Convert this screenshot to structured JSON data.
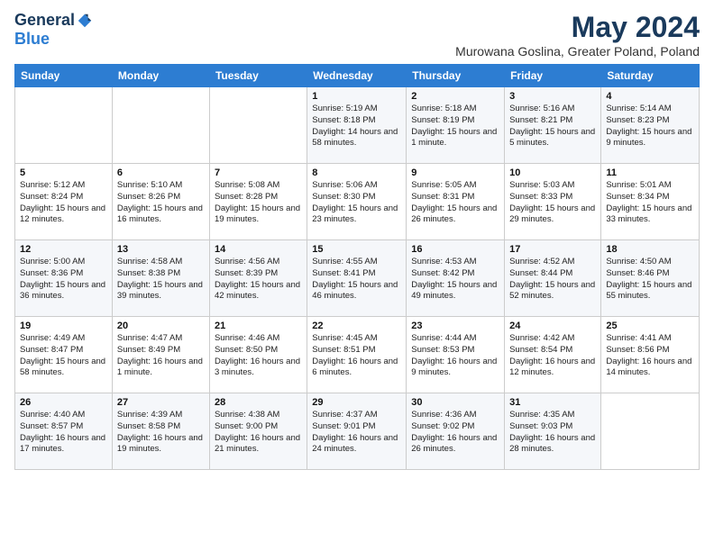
{
  "header": {
    "logo": {
      "general": "General",
      "blue": "Blue"
    },
    "title": "May 2024",
    "subtitle": "Murowana Goslina, Greater Poland, Poland"
  },
  "calendar": {
    "weekdays": [
      "Sunday",
      "Monday",
      "Tuesday",
      "Wednesday",
      "Thursday",
      "Friday",
      "Saturday"
    ],
    "weeks": [
      [
        {
          "day": "",
          "info": ""
        },
        {
          "day": "",
          "info": ""
        },
        {
          "day": "",
          "info": ""
        },
        {
          "day": "1",
          "info": "Sunrise: 5:19 AM\nSunset: 8:18 PM\nDaylight: 14 hours\nand 58 minutes."
        },
        {
          "day": "2",
          "info": "Sunrise: 5:18 AM\nSunset: 8:19 PM\nDaylight: 15 hours\nand 1 minute."
        },
        {
          "day": "3",
          "info": "Sunrise: 5:16 AM\nSunset: 8:21 PM\nDaylight: 15 hours\nand 5 minutes."
        },
        {
          "day": "4",
          "info": "Sunrise: 5:14 AM\nSunset: 8:23 PM\nDaylight: 15 hours\nand 9 minutes."
        }
      ],
      [
        {
          "day": "5",
          "info": "Sunrise: 5:12 AM\nSunset: 8:24 PM\nDaylight: 15 hours\nand 12 minutes."
        },
        {
          "day": "6",
          "info": "Sunrise: 5:10 AM\nSunset: 8:26 PM\nDaylight: 15 hours\nand 16 minutes."
        },
        {
          "day": "7",
          "info": "Sunrise: 5:08 AM\nSunset: 8:28 PM\nDaylight: 15 hours\nand 19 minutes."
        },
        {
          "day": "8",
          "info": "Sunrise: 5:06 AM\nSunset: 8:30 PM\nDaylight: 15 hours\nand 23 minutes."
        },
        {
          "day": "9",
          "info": "Sunrise: 5:05 AM\nSunset: 8:31 PM\nDaylight: 15 hours\nand 26 minutes."
        },
        {
          "day": "10",
          "info": "Sunrise: 5:03 AM\nSunset: 8:33 PM\nDaylight: 15 hours\nand 29 minutes."
        },
        {
          "day": "11",
          "info": "Sunrise: 5:01 AM\nSunset: 8:34 PM\nDaylight: 15 hours\nand 33 minutes."
        }
      ],
      [
        {
          "day": "12",
          "info": "Sunrise: 5:00 AM\nSunset: 8:36 PM\nDaylight: 15 hours\nand 36 minutes."
        },
        {
          "day": "13",
          "info": "Sunrise: 4:58 AM\nSunset: 8:38 PM\nDaylight: 15 hours\nand 39 minutes."
        },
        {
          "day": "14",
          "info": "Sunrise: 4:56 AM\nSunset: 8:39 PM\nDaylight: 15 hours\nand 42 minutes."
        },
        {
          "day": "15",
          "info": "Sunrise: 4:55 AM\nSunset: 8:41 PM\nDaylight: 15 hours\nand 46 minutes."
        },
        {
          "day": "16",
          "info": "Sunrise: 4:53 AM\nSunset: 8:42 PM\nDaylight: 15 hours\nand 49 minutes."
        },
        {
          "day": "17",
          "info": "Sunrise: 4:52 AM\nSunset: 8:44 PM\nDaylight: 15 hours\nand 52 minutes."
        },
        {
          "day": "18",
          "info": "Sunrise: 4:50 AM\nSunset: 8:46 PM\nDaylight: 15 hours\nand 55 minutes."
        }
      ],
      [
        {
          "day": "19",
          "info": "Sunrise: 4:49 AM\nSunset: 8:47 PM\nDaylight: 15 hours\nand 58 minutes."
        },
        {
          "day": "20",
          "info": "Sunrise: 4:47 AM\nSunset: 8:49 PM\nDaylight: 16 hours\nand 1 minute."
        },
        {
          "day": "21",
          "info": "Sunrise: 4:46 AM\nSunset: 8:50 PM\nDaylight: 16 hours\nand 3 minutes."
        },
        {
          "day": "22",
          "info": "Sunrise: 4:45 AM\nSunset: 8:51 PM\nDaylight: 16 hours\nand 6 minutes."
        },
        {
          "day": "23",
          "info": "Sunrise: 4:44 AM\nSunset: 8:53 PM\nDaylight: 16 hours\nand 9 minutes."
        },
        {
          "day": "24",
          "info": "Sunrise: 4:42 AM\nSunset: 8:54 PM\nDaylight: 16 hours\nand 12 minutes."
        },
        {
          "day": "25",
          "info": "Sunrise: 4:41 AM\nSunset: 8:56 PM\nDaylight: 16 hours\nand 14 minutes."
        }
      ],
      [
        {
          "day": "26",
          "info": "Sunrise: 4:40 AM\nSunset: 8:57 PM\nDaylight: 16 hours\nand 17 minutes."
        },
        {
          "day": "27",
          "info": "Sunrise: 4:39 AM\nSunset: 8:58 PM\nDaylight: 16 hours\nand 19 minutes."
        },
        {
          "day": "28",
          "info": "Sunrise: 4:38 AM\nSunset: 9:00 PM\nDaylight: 16 hours\nand 21 minutes."
        },
        {
          "day": "29",
          "info": "Sunrise: 4:37 AM\nSunset: 9:01 PM\nDaylight: 16 hours\nand 24 minutes."
        },
        {
          "day": "30",
          "info": "Sunrise: 4:36 AM\nSunset: 9:02 PM\nDaylight: 16 hours\nand 26 minutes."
        },
        {
          "day": "31",
          "info": "Sunrise: 4:35 AM\nSunset: 9:03 PM\nDaylight: 16 hours\nand 28 minutes."
        },
        {
          "day": "",
          "info": ""
        }
      ]
    ]
  }
}
